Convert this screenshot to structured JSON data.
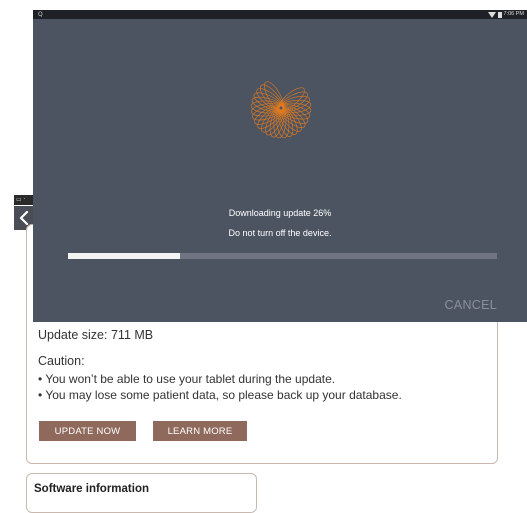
{
  "status_bar": {
    "left_icon": "Q",
    "time": "7:06 PM",
    "icons": [
      "wifi-icon",
      "battery-icon"
    ]
  },
  "background": {
    "update_size_label": "Update size:",
    "update_size_value": "711 MB",
    "caution_title": "Caution:",
    "caution_items": [
      "• You won’t be able to use your tablet during the update.",
      "• You may lose some patient data, so please back up your database."
    ],
    "buttons": {
      "update_now": "UPDATE NOW",
      "learn_more": "LEARN MORE"
    },
    "software_info_title": "Software information"
  },
  "dialog": {
    "progress_text": "Downloading update 26%",
    "warning_text": "Do not turn off the device.",
    "progress_fraction": 0.26,
    "cancel_label": "CANCEL"
  },
  "colors": {
    "dialog_bg": "#4d5461",
    "accent_button": "#8f6a5c",
    "logo_orange": "#e07a1f"
  }
}
